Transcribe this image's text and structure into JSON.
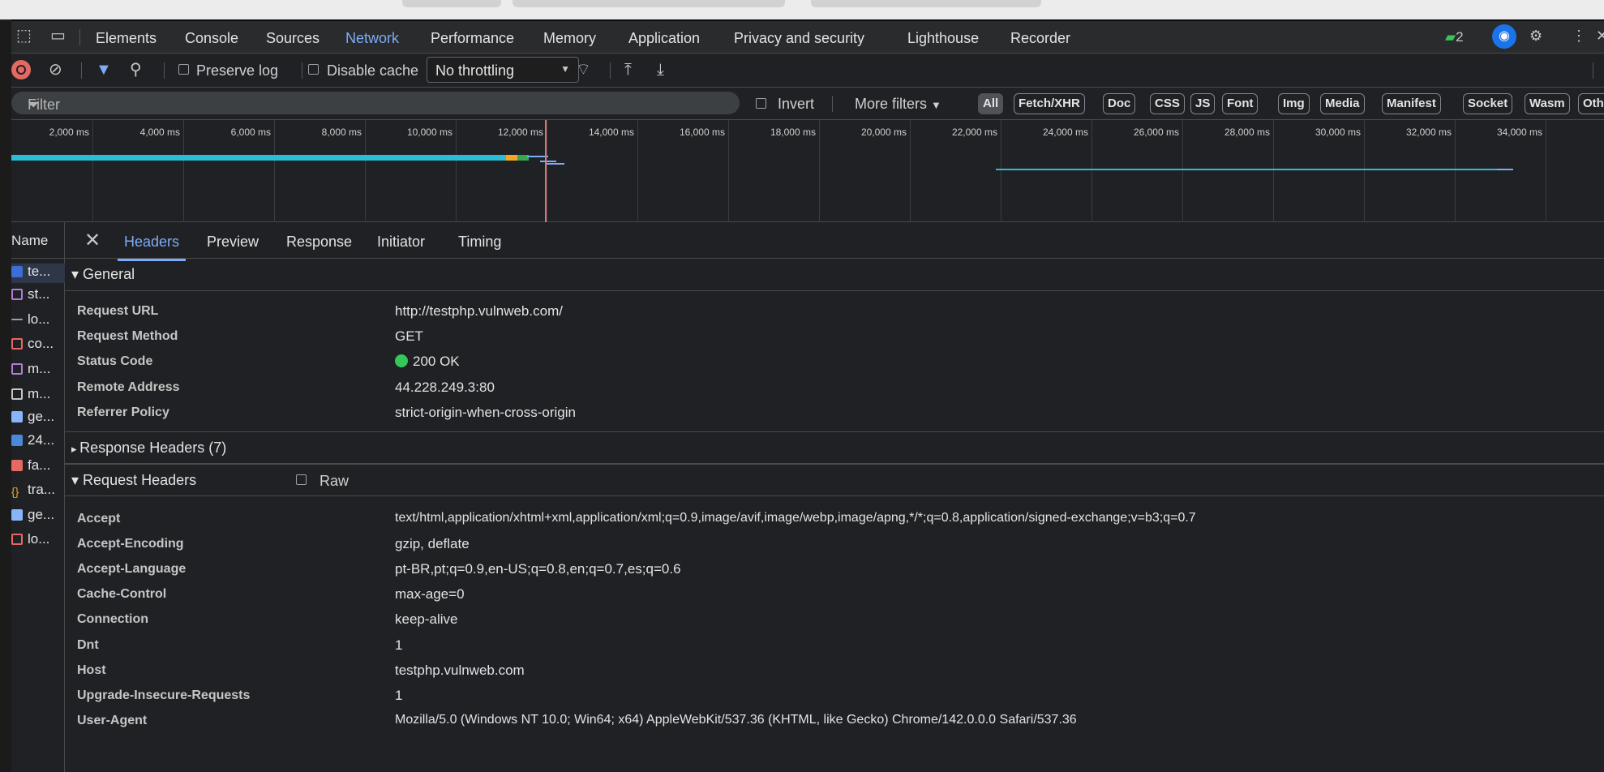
{
  "panel_tabs": [
    "Elements",
    "Console",
    "Sources",
    "Network",
    "Performance",
    "Memory",
    "Application",
    "Privacy and security",
    "Lighthouse",
    "Recorder"
  ],
  "active_panel_tab": "Network",
  "issues_badge": "2",
  "toolbar": {
    "preserve_log": "Preserve log",
    "disable_cache": "Disable cache",
    "throttling": "No throttling"
  },
  "filter": {
    "placeholder": "Filter",
    "invert": "Invert",
    "more_filters": "More filters",
    "types": [
      "All",
      "Fetch/XHR",
      "Doc",
      "CSS",
      "JS",
      "Font",
      "Img",
      "Media",
      "Manifest",
      "Socket",
      "Wasm",
      "Oth"
    ]
  },
  "timeline": {
    "ticks": [
      "2,000 ms",
      "4,000 ms",
      "6,000 ms",
      "8,000 ms",
      "10,000 ms",
      "12,000 ms",
      "14,000 ms",
      "16,000 ms",
      "18,000 ms",
      "20,000 ms",
      "22,000 ms",
      "24,000 ms",
      "26,000 ms",
      "28,000 ms",
      "30,000 ms",
      "32,000 ms",
      "34,000 ms",
      "36,0"
    ]
  },
  "requests": {
    "header": "Name",
    "items": [
      "te...",
      "st...",
      "lo...",
      "co...",
      "m...",
      "m...",
      "ge...",
      "24...",
      "fa...",
      "tra...",
      "ge...",
      "lo..."
    ]
  },
  "detail": {
    "tabs": [
      "Headers",
      "Preview",
      "Response",
      "Initiator",
      "Timing"
    ],
    "active_tab": "Headers",
    "general": {
      "title": "General",
      "rows": [
        {
          "name": "Request URL",
          "value": "http://testphp.vulnweb.com/"
        },
        {
          "name": "Request Method",
          "value": "GET"
        },
        {
          "name": "Status Code",
          "value": "200 OK"
        },
        {
          "name": "Remote Address",
          "value": "44.228.249.3:80"
        },
        {
          "name": "Referrer Policy",
          "value": "strict-origin-when-cross-origin"
        }
      ]
    },
    "response_headers": {
      "title": "Response Headers (7)"
    },
    "request_headers": {
      "title": "Request Headers",
      "raw_label": "Raw",
      "rows": [
        {
          "name": "Accept",
          "value": "text/html,application/xhtml+xml,application/xml;q=0.9,image/avif,image/webp,image/apng,*/*;q=0.8,application/signed-exchange;v=b3;q=0.7"
        },
        {
          "name": "Accept-Encoding",
          "value": "gzip, deflate"
        },
        {
          "name": "Accept-Language",
          "value": "pt-BR,pt;q=0.9,en-US;q=0.8,en;q=0.7,es;q=0.6"
        },
        {
          "name": "Cache-Control",
          "value": "max-age=0"
        },
        {
          "name": "Connection",
          "value": "keep-alive"
        },
        {
          "name": "Dnt",
          "value": "1"
        },
        {
          "name": "Host",
          "value": "testphp.vulnweb.com"
        },
        {
          "name": "Upgrade-Insecure-Requests",
          "value": "1"
        },
        {
          "name": "User-Agent",
          "value": "Mozilla/5.0 (Windows NT 10.0; Win64; x64) AppleWebKit/537.36 (KHTML, like Gecko) Chrome/142.0.0.0 Safari/537.36"
        }
      ]
    }
  },
  "colors": {
    "accent": "#7cacf8",
    "status_ok": "#34c759",
    "record": "#e46962",
    "filter_active": "#7cacf8"
  }
}
